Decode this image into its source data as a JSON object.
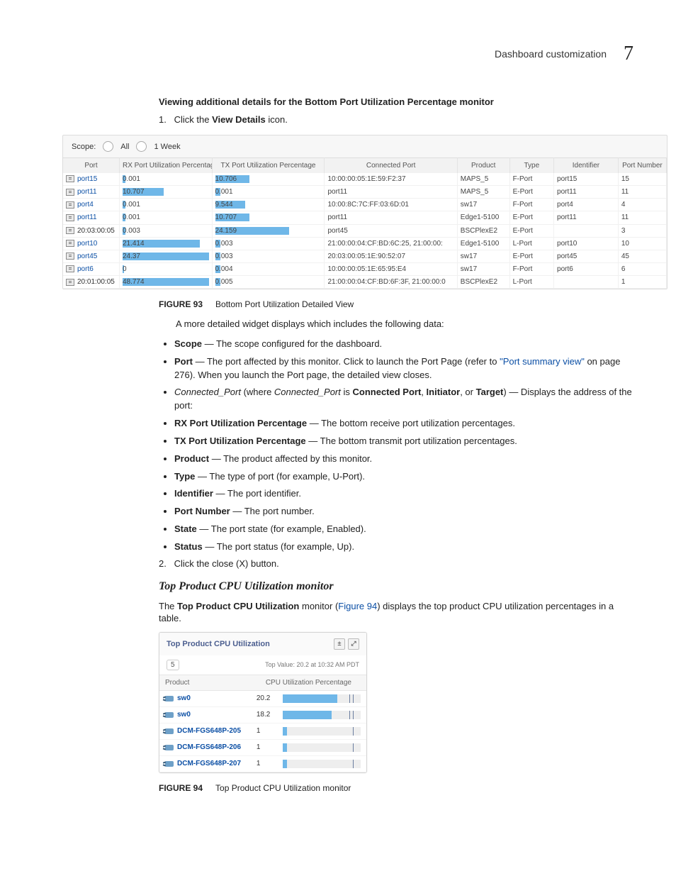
{
  "header": {
    "section": "Dashboard customization",
    "chapter": "7"
  },
  "section1": {
    "title": "Viewing additional details for the Bottom Port Utilization Percentage monitor",
    "step1_num": "1.",
    "step1_a": "Click the ",
    "step1_b": "View Details",
    "step1_c": " icon."
  },
  "fig93": {
    "scope_label": "Scope:",
    "scope_all": "All",
    "scope_time": "1 Week",
    "cols": [
      "Port",
      "RX Port Utilization Percentage",
      "TX Port Utilization Percentage",
      "Connected Port",
      "Product",
      "Type",
      "Identifier",
      "Port Number"
    ],
    "rows": [
      {
        "port": "port15",
        "plink": true,
        "rx": "0.001",
        "rx_w": 3,
        "tx": "10.706",
        "tx_w": 32,
        "conn": "10:00:00:05:1E:59:F2:37",
        "prod": "MAPS_5",
        "type": "F-Port",
        "id": "port15",
        "num": "15"
      },
      {
        "port": "port11",
        "plink": true,
        "rx": "10.707",
        "rx_w": 48,
        "tx": "0.001",
        "tx_w": 5,
        "conn": "port11",
        "prod": "MAPS_5",
        "type": "E-Port",
        "id": "port11",
        "num": "11"
      },
      {
        "port": "port4",
        "plink": true,
        "rx": "0.001",
        "rx_w": 3,
        "tx": "9.544",
        "tx_w": 28,
        "conn": "10:00:8C:7C:FF:03:6D:01",
        "prod": "sw17",
        "type": "F-Port",
        "id": "port4",
        "num": "4"
      },
      {
        "port": "port11",
        "plink": true,
        "rx": "0.001",
        "rx_w": 3,
        "tx": "10.707",
        "tx_w": 32,
        "conn": "port11",
        "prod": "Edge1-5100",
        "type": "E-Port",
        "id": "port11",
        "num": "11"
      },
      {
        "port": "20:03:00:05",
        "plink": false,
        "rx": "0.003",
        "rx_w": 3,
        "tx": "24.159",
        "tx_w": 70,
        "conn": "port45",
        "prod": "BSCPlexE2",
        "type": "E-Port",
        "id": "",
        "num": "3"
      },
      {
        "port": "port10",
        "plink": true,
        "rx": "21.414",
        "rx_w": 90,
        "tx": "0.003",
        "tx_w": 5,
        "conn": "21:00:00:04:CF:BD:6C:25, 21:00:00:",
        "prod": "Edge1-5100",
        "type": "L-Port",
        "id": "port10",
        "num": "10"
      },
      {
        "port": "port45",
        "plink": true,
        "rx": "24.37",
        "rx_w": 100,
        "tx": "0.003",
        "tx_w": 5,
        "conn": "20:03:00:05:1E:90:52:07",
        "prod": "sw17",
        "type": "E-Port",
        "id": "port45",
        "num": "45"
      },
      {
        "port": "port6",
        "plink": true,
        "rx": "0",
        "rx_w": 2,
        "tx": "0.004",
        "tx_w": 5,
        "conn": "10:00:00:05:1E:65:95:E4",
        "prod": "sw17",
        "type": "F-Port",
        "id": "port6",
        "num": "6"
      },
      {
        "port": "20:01:00:05",
        "plink": false,
        "rx": "48.774",
        "rx_w": 100,
        "tx": "0.005",
        "tx_w": 5,
        "conn": "21:00:00:04:CF:BD:6F:3F, 21:00:00:0",
        "prod": "BSCPlexE2",
        "type": "L-Port",
        "id": "",
        "num": "1"
      }
    ],
    "caption_label": "FIGURE 93",
    "caption_text": "Bottom Port Utilization Detailed View"
  },
  "aftertable": {
    "intro": "A more detailed widget displays which includes the following data:",
    "items": [
      {
        "b": "Scope",
        "t": " — The scope configured for the dashboard."
      },
      {
        "b": "Port",
        "t": " — The port affected by this monitor. Click to launch the Port Page (refer to ",
        "link": "\"Port summary view\"",
        "t2": " on page 276). When you launch the Port page, the detailed view closes."
      },
      {
        "i": "Connected_Port",
        "t0": " (where ",
        "i2": "Connected_Port",
        "t1": " is ",
        "b": "Connected Port",
        "t2": ", ",
        "b2": "Initiator",
        "t3": ", or ",
        "b3": "Target",
        "t4": ") — Displays the address of the port:"
      },
      {
        "b": "RX Port Utilization Percentage",
        "t": " — The bottom receive port utilization percentages."
      },
      {
        "b": "TX Port Utilization Percentage",
        "t": " — The bottom transmit port utilization percentages."
      },
      {
        "b": "Product",
        "t": " — The product affected by this monitor."
      },
      {
        "b": "Type",
        "t": " — The type of port (for example, U-Port)."
      },
      {
        "b": "Identifier",
        "t": " — The port identifier."
      },
      {
        "b": "Port Number",
        "t": " — The port number."
      },
      {
        "b": "State",
        "t": " — The port state (for example, Enabled)."
      },
      {
        "b": "Status",
        "t": " — The port status (for example, Up)."
      }
    ],
    "step2_num": "2.",
    "step2_text": "Click the close (X) button."
  },
  "sec2": {
    "heading": "Top Product CPU Utilization monitor",
    "para_a": "The ",
    "para_b": "Top Product CPU Utilization",
    "para_c": " monitor (",
    "para_link": "Figure 94",
    "para_d": ") displays the top product CPU utilization percentages in a table."
  },
  "fig94": {
    "title": "Top Product CPU Utilization",
    "count": "5",
    "topval": "Top Value: 20.2 at 10:32 AM PDT",
    "cols": [
      "Product",
      "CPU Utilization Percentage"
    ],
    "rows": [
      {
        "name": "sw0",
        "val": "20.2",
        "w": 70,
        "ticks": 2
      },
      {
        "name": "sw0",
        "val": "18.2",
        "w": 63,
        "ticks": 2
      },
      {
        "name": "DCM-FGS648P-205",
        "val": "1",
        "w": 5,
        "ticks": 1
      },
      {
        "name": "DCM-FGS648P-206",
        "val": "1",
        "w": 5,
        "ticks": 1
      },
      {
        "name": "DCM-FGS648P-207",
        "val": "1",
        "w": 5,
        "ticks": 1
      }
    ],
    "caption_label": "FIGURE 94",
    "caption_text": "Top Product CPU Utilization monitor"
  },
  "chart_data": {
    "type": "table",
    "title": "Top Product CPU Utilization",
    "columns": [
      "Product",
      "CPU Utilization Percentage"
    ],
    "rows": [
      [
        "sw0",
        20.2
      ],
      [
        "sw0",
        18.2
      ],
      [
        "DCM-FGS648P-205",
        1
      ],
      [
        "DCM-FGS648P-206",
        1
      ],
      [
        "DCM-FGS648P-207",
        1
      ]
    ],
    "top_value": "20.2 at 10:32 AM PDT"
  }
}
